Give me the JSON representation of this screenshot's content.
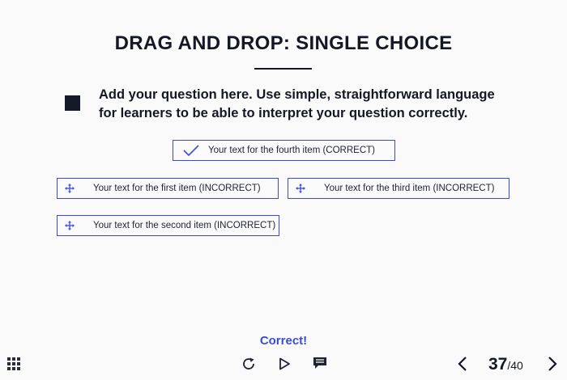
{
  "slide": {
    "title": "DRAG AND DROP: SINGLE CHOICE",
    "question": "Add your question here. Use simple, straightforward language for learners to be able to interpret your question correctly."
  },
  "answers": {
    "correct": {
      "label": "Your text for the fourth item (CORRECT)",
      "icon": "checkmark-icon"
    },
    "first": {
      "label": "Your text for the first item (INCORRECT)",
      "icon": "move-icon"
    },
    "third": {
      "label": "Your text for the third item (INCORRECT)",
      "icon": "move-icon"
    },
    "second": {
      "label": "Your text for the second item (INCORRECT)",
      "icon": "move-icon"
    }
  },
  "feedback": "Correct!",
  "player": {
    "current_page": "37",
    "total_pages": "/40",
    "icons": [
      "grid-menu-icon",
      "replay-icon",
      "play-icon",
      "notes-icon",
      "chevron-left-icon",
      "chevron-right-icon"
    ]
  },
  "colors": {
    "accent": "#3b4bd8",
    "text": "#141724",
    "background": "#fafafa"
  }
}
